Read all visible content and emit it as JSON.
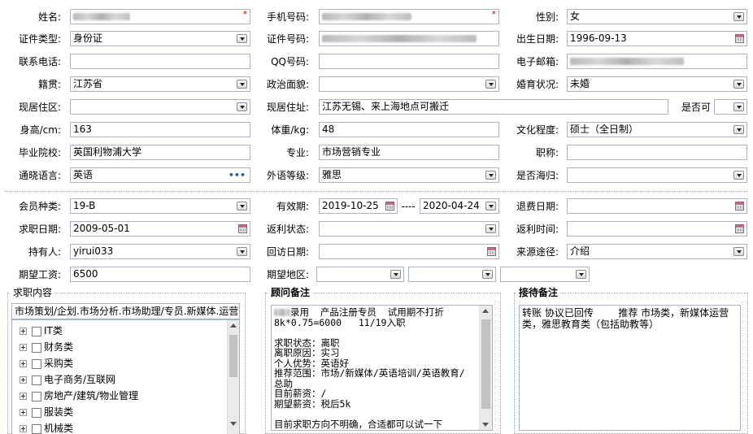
{
  "basic": {
    "name_label": "姓名:",
    "mobile_label": "手机号码:",
    "gender_label": "性别:",
    "gender_value": "女",
    "idtype_label": "证件类型:",
    "idtype_value": "身份证",
    "idno_label": "证件号码:",
    "birth_label": "出生日期:",
    "birth_value": "1996-09-13",
    "phone_label": "联系电话:",
    "qq_label": "QQ号码:",
    "email_label": "电子邮箱:",
    "native_label": "籍贯:",
    "native_value": "江苏省",
    "political_label": "政治面貌:",
    "marital_label": "婚育状况:",
    "marital_value": "未婚",
    "residence_label": "现居住区:",
    "address_label": "现居住址:",
    "address_value": "江苏无锡、来上海地点可搬迁",
    "canbe_label": "是否可",
    "height_label": "身高/cm:",
    "height_value": "163",
    "weight_label": "体重/kg:",
    "weight_value": "48",
    "edu_label": "文化程度:",
    "edu_value": "硕士（全日制）",
    "school_label": "毕业院校:",
    "school_value": "英国利物浦大学",
    "major_label": "专业:",
    "major_value": "市场营销专业",
    "title_label": "职称:",
    "lang_label": "通晓语言:",
    "lang_value": "英语",
    "langlevel_label": "外语等级:",
    "langlevel_value": "雅思",
    "overseas_label": "是否海归:"
  },
  "member": {
    "type_label": "会员种类:",
    "type_value": "19-B",
    "valid_label": "有效期:",
    "valid_from": "2019-10-25",
    "valid_sep": "----",
    "valid_to": "2020-04-24",
    "refund_label": "退费日期:",
    "jobdate_label": "求职日期:",
    "jobdate_value": "2009-05-01",
    "rebate_status_label": "返利状态:",
    "rebate_time_label": "返利时间:",
    "holder_label": "持有人:",
    "holder_value": "yirui033",
    "visit_label": "回访日期:",
    "source_label": "来源途径:",
    "source_value": "介绍",
    "salary_label": "期望工资:",
    "salary_value": "6500",
    "region_label": "期望地区:"
  },
  "job": {
    "title": "求职内容",
    "summary": "市场策划/企划.市场分析.市场助理/专员.新媒体.运营:",
    "tree": [
      "IT类",
      "财务类",
      "采购类",
      "电子商务/互联网",
      "房地产/建筑/物业管理",
      "服装类",
      "机械类"
    ]
  },
  "advisor": {
    "title": "顾问备注",
    "text": "录用  产品注册专员  试用期不打折\n8k*0.75=6000   11/19入职\n\n求职状态：离职\n离职原因：实习\n个人优势：英语好\n推荐范围：市场/新媒体/英语培训/英语教育/\n总助\n目前薪资：/\n期望薪资：税后5k\n\n目前求职方向不明确，合适都可以试一下"
  },
  "reception": {
    "title": "接待备注",
    "text": "转账 协议已回传        推荐 市场类，新媒体运营类，雅思教育类（包括助教等）"
  },
  "colors": {
    "border": "#a9b3c1",
    "required": "#e00000"
  }
}
